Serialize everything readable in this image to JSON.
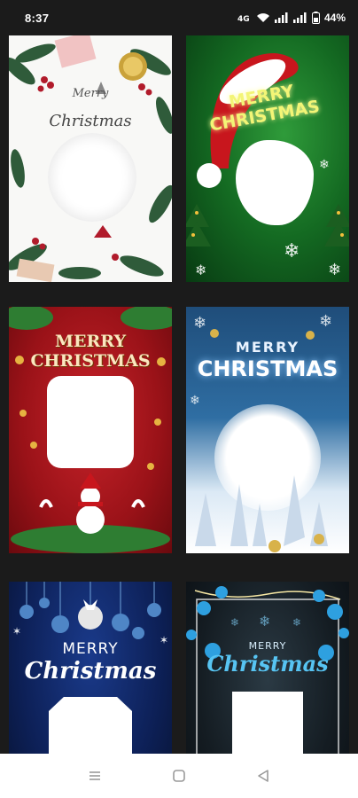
{
  "status_bar": {
    "time": "8:37",
    "battery": "44%"
  },
  "templates": [
    {
      "title_line1": "Merry",
      "title_line2": "Christmas",
      "colors": {
        "bg": "#f8f8f6",
        "accent": "#2f5b3a"
      }
    },
    {
      "title_line1": "MERRY",
      "title_line2": "CHRISTMAS",
      "colors": {
        "bg": "#146a22",
        "accent": "#f3f576"
      }
    },
    {
      "title_line1": "MERRY",
      "title_line2": "CHRISTMAS",
      "colors": {
        "bg": "#9a1218",
        "accent": "#fbe7c0"
      }
    },
    {
      "title_line1": "MERRY",
      "title_line2": "CHRISTMAS",
      "colors": {
        "bg": "#2f6ea3",
        "accent": "#ffffff"
      }
    },
    {
      "title_line1": "MERRY",
      "title_line2": "Christmas",
      "colors": {
        "bg": "#0d2057",
        "accent": "#ffffff"
      }
    },
    {
      "title_line1": "MERRY",
      "title_line2": "Christmas",
      "colors": {
        "bg": "#141c22",
        "accent": "#57c4f2"
      }
    }
  ],
  "nav": {
    "recents_icon": "menu-lines-icon",
    "home_icon": "square-icon",
    "back_icon": "triangle-back-icon"
  }
}
